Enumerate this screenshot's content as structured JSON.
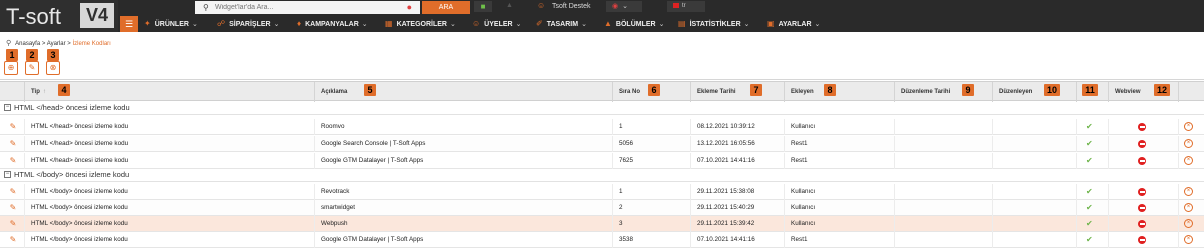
{
  "logo": {
    "text": "T-soft",
    "version": "V4"
  },
  "search": {
    "placeholder": "Widget'lar'da Ara...",
    "value": "",
    "button_label": "ARA"
  },
  "user": {
    "name": "Tsoft Destek"
  },
  "language": {
    "code": "tr"
  },
  "menu": [
    {
      "label": "ÜRÜNLER"
    },
    {
      "label": "SİPARİŞLER"
    },
    {
      "label": "KAMPANYALAR"
    },
    {
      "label": "KATEGORİLER"
    },
    {
      "label": "ÜYELER"
    },
    {
      "label": "TASARIM"
    },
    {
      "label": "BÖLÜMLER"
    },
    {
      "label": "İSTATİSTİKLER"
    },
    {
      "label": "AYARLAR"
    }
  ],
  "breadcrumb": {
    "items": [
      "Anasayfa",
      "Ayarlar"
    ],
    "current": "İzleme Kodları",
    "separator": ">"
  },
  "badges": [
    "1",
    "2",
    "3",
    "4",
    "5",
    "6",
    "7",
    "8",
    "9",
    "10",
    "11",
    "12"
  ],
  "table": {
    "columns": [
      "Tip",
      "Açıklama",
      "Sıra No",
      "Ekleme Tarihi",
      "Ekleyen",
      "Düzenleme Tarihi",
      "Düzenleyen",
      "",
      "Webview",
      ""
    ],
    "sort_arrow": "↑",
    "groups": [
      {
        "label": "HTML </head> öncesi izleme kodu",
        "rows": [
          {
            "tip": "HTML </head> öncesi izleme kodu",
            "aciklama": "Roomvo",
            "sira": "1",
            "tarih": "08.12.2021 10:39:12",
            "ekleyen": "Kullanıcı",
            "duz_tarih": "",
            "duzenleyen": ""
          },
          {
            "tip": "HTML </head> öncesi izleme kodu",
            "aciklama": "Google Search Console | T-Soft Apps",
            "sira": "5056",
            "tarih": "13.12.2021 16:05:56",
            "ekleyen": "Rest1",
            "duz_tarih": "",
            "duzenleyen": ""
          },
          {
            "tip": "HTML </head> öncesi izleme kodu",
            "aciklama": "Google GTM Datalayer | T-Soft Apps",
            "sira": "7625",
            "tarih": "07.10.2021 14:41:16",
            "ekleyen": "Rest1",
            "duz_tarih": "",
            "duzenleyen": ""
          }
        ]
      },
      {
        "label": "HTML </body> öncesi izleme kodu",
        "rows": [
          {
            "tip": "HTML </body> öncesi izleme kodu",
            "aciklama": "Revotrack",
            "sira": "1",
            "tarih": "29.11.2021 15:38:08",
            "ekleyen": "Kullanıcı",
            "duz_tarih": "",
            "duzenleyen": ""
          },
          {
            "tip": "HTML </body> öncesi izleme kodu",
            "aciklama": "smartwidget",
            "sira": "2",
            "tarih": "29.11.2021 15:40:29",
            "ekleyen": "Kullanıcı",
            "duz_tarih": "",
            "duzenleyen": ""
          },
          {
            "tip": "HTML </body> öncesi izleme kodu",
            "aciklama": "Webpush",
            "sira": "3",
            "tarih": "29.11.2021 15:39:42",
            "ekleyen": "Kullanıcı",
            "duz_tarih": "",
            "duzenleyen": ""
          },
          {
            "tip": "HTML </body> öncesi izleme kodu",
            "aciklama": "Google GTM Datalayer | T-Soft Apps",
            "sira": "3538",
            "tarih": "07.10.2021 14:41:16",
            "ekleyen": "Rest1",
            "duz_tarih": "",
            "duzenleyen": ""
          }
        ]
      }
    ]
  },
  "colors": {
    "accent": "#e06d2a",
    "topbar": "#2a2a2a",
    "check": "#6db44a",
    "danger": "#e02020",
    "highlight_row": "#fbe7dc"
  },
  "icons": {
    "search": "search-icon",
    "mic": "mic-icon",
    "chat": "chat-icon",
    "bell": "bell-icon",
    "user": "user-icon",
    "eye": "eye-icon",
    "home": "home-icon",
    "add": "add-icon",
    "edit": "edit-icon",
    "delete": "delete-icon",
    "check": "check-icon",
    "disabled": "disabled-icon"
  }
}
